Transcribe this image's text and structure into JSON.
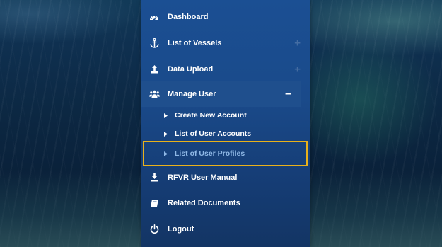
{
  "sidebar": {
    "items": [
      {
        "label": "Dashboard",
        "icon": "dashboard-icon"
      },
      {
        "label": "List of Vessels",
        "icon": "anchor-icon",
        "expander": "+"
      },
      {
        "label": "Data Upload",
        "icon": "upload-icon",
        "expander": "+"
      },
      {
        "label": "Manage User",
        "icon": "users-icon",
        "expander": "–"
      },
      {
        "label": "RFVR User Manual",
        "icon": "download-icon"
      },
      {
        "label": "Related Documents",
        "icon": "book-icon"
      },
      {
        "label": "Logout",
        "icon": "power-icon"
      }
    ],
    "submenu": [
      {
        "label": "Create New Account"
      },
      {
        "label": "List of User Accounts"
      },
      {
        "label": "List of User Profiles",
        "selected": true
      }
    ]
  },
  "colors": {
    "sidebar": "#1b4f93",
    "highlight": "#e9b11b",
    "selected_text": "#8fb8e6"
  }
}
